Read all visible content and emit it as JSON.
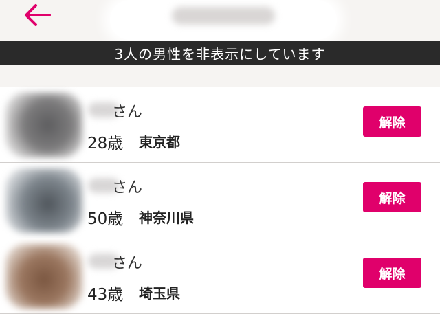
{
  "header": {
    "back_icon": "arrow-left-icon",
    "accent_color": "#e0006b"
  },
  "banner": {
    "text": "3人の男性を非表示にしています"
  },
  "users": [
    {
      "name_suffix": "さん",
      "age": "28歳",
      "prefecture": "東京都",
      "unhide_label": "解除"
    },
    {
      "name_suffix": "さん",
      "age": "50歳",
      "prefecture": "神奈川県",
      "unhide_label": "解除"
    },
    {
      "name_suffix": "さん",
      "age": "43歳",
      "prefecture": "埼玉県",
      "unhide_label": "解除"
    }
  ]
}
